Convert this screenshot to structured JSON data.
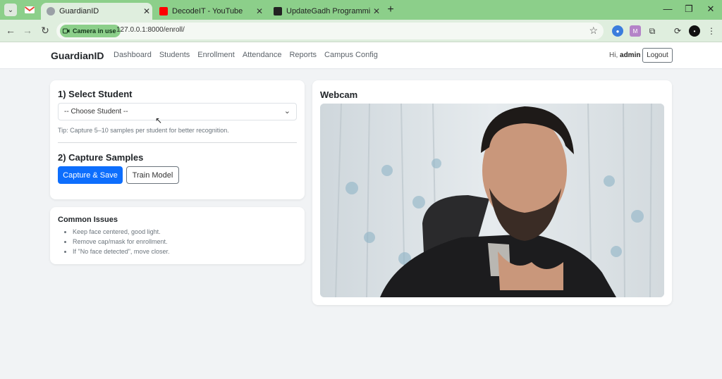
{
  "browser": {
    "tabs": [
      {
        "title": "GuardianID",
        "active": true
      },
      {
        "title": "DecodeIT - YouTube",
        "active": false
      },
      {
        "title": "UpdateGadh Programming - U",
        "active": false
      }
    ],
    "camera_chip": "Camera in use",
    "url": "127.0.0.1:8000/enroll/"
  },
  "navbar": {
    "brand": "GuardianID",
    "links": [
      "Dashboard",
      "Students",
      "Enrollment",
      "Attendance",
      "Reports",
      "Campus Config"
    ],
    "greeting": "Hi,",
    "username": "admin",
    "logout_label": "Logout"
  },
  "select_student": {
    "heading": "1) Select Student",
    "placeholder": "-- Choose Student --",
    "tip": "Tip: Capture 5–10 samples per student for better recognition."
  },
  "capture": {
    "heading": "2) Capture Samples",
    "capture_label": "Capture & Save",
    "train_label": "Train Model"
  },
  "issues": {
    "title": "Common Issues",
    "items": [
      "Keep face centered, good light.",
      "Remove cap/mask for enrollment.",
      "If \"No face detected\", move closer."
    ]
  },
  "webcam": {
    "heading": "Webcam"
  },
  "colors": {
    "primary": "#0d6efd",
    "chrome_green": "#8ccf8a",
    "page_bg": "#f1f3f5"
  }
}
